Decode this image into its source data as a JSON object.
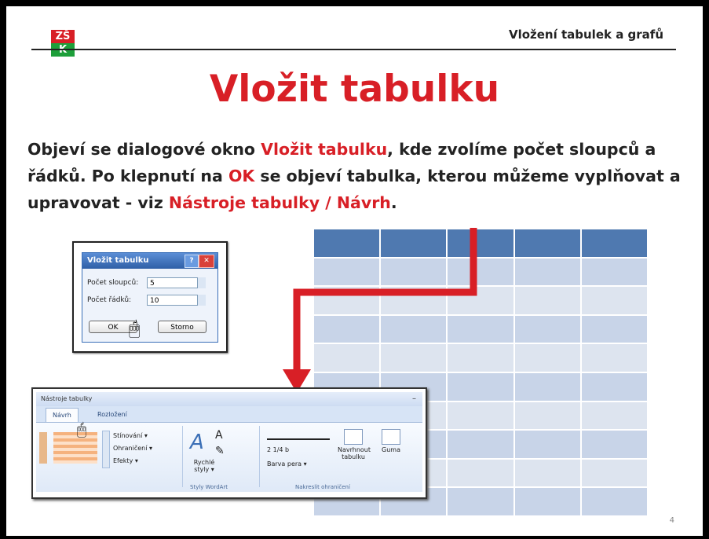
{
  "logo": {
    "line1": "ZŠ",
    "line2": "K"
  },
  "header": {
    "section_title": "Vložení tabulek a grafů"
  },
  "slide": {
    "title": "Vložit tabulku",
    "body": {
      "p1": "Objeví se dialogové okno ",
      "hl1": "Vložit tabulku",
      "p2": ", kde zvolíme počet sloupců a řádků. Po klepnutí na ",
      "hl2": "OK",
      "p3": " se objeví tabulka, kterou můžeme vyplňovat a upravovat - viz ",
      "hl3": "Nástroje tabulky / Návrh",
      "p4": "."
    },
    "page_number": "4"
  },
  "dialog": {
    "title": "Vložit tabulku",
    "help": "?",
    "close": "✕",
    "columns_label": "Počet sloupců:",
    "columns_value": "5",
    "rows_label": "Počet řádků:",
    "rows_value": "10",
    "ok_label": "OK",
    "cancel_label": "Storno"
  },
  "ribbon": {
    "context_title": "Nástroje tabulky",
    "minimize": "–",
    "tabs": [
      "Návrh",
      "Rozložení"
    ],
    "shading": "Stínování ▾",
    "borders": "Ohraničení ▾",
    "effects": "Efekty ▾",
    "quick_styles": "Rychlé styly ▾",
    "wordart_group": "Styly WordArt",
    "pen_weight": "2 1/4 b",
    "pen_color": "Barva pera ▾",
    "draw_table": "Navrhnout tabulku",
    "eraser": "Guma",
    "draw_borders_group": "Nakreslit ohraničení"
  },
  "colors": {
    "accent_red": "#d81f26",
    "table_header": "#4f79b0",
    "table_row": "#dde4ef"
  }
}
